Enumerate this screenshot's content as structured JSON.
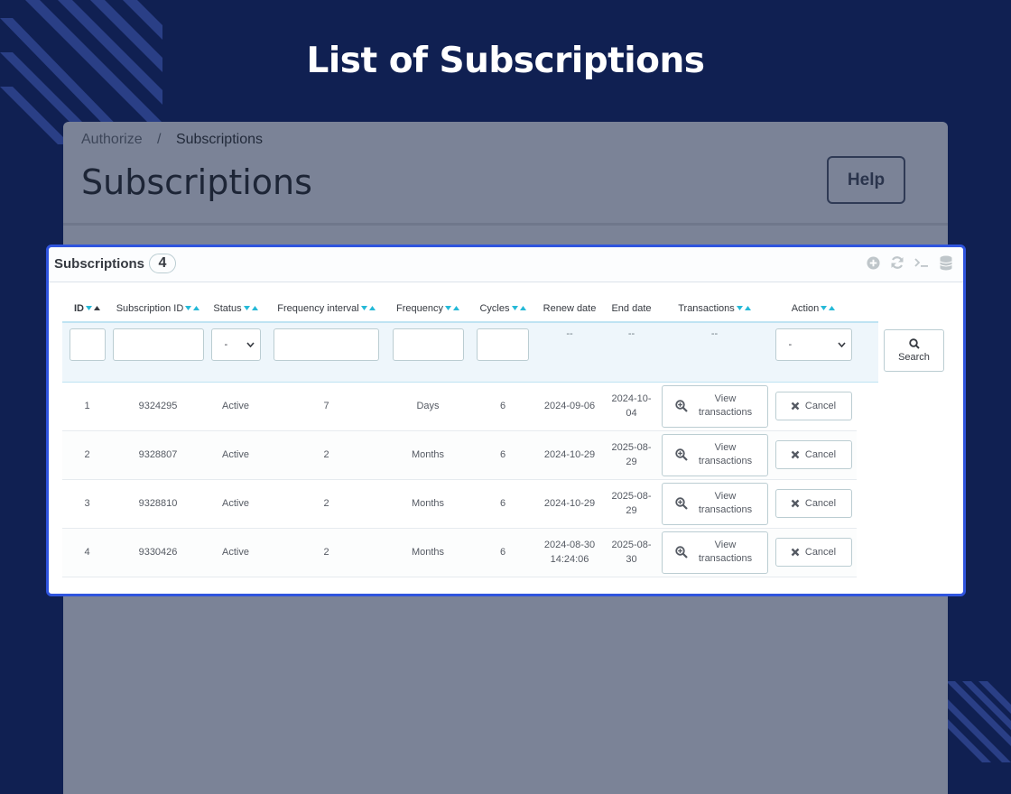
{
  "hero": {
    "title": "List of Subscriptions"
  },
  "background": {
    "breadcrumb": {
      "parent": "Authorize",
      "separator": "/",
      "current": "Subscriptions"
    },
    "page_title": "Subscriptions",
    "help_label": "Help"
  },
  "panel": {
    "title": "Subscriptions",
    "count": "4",
    "icons": [
      "add-icon",
      "refresh-icon",
      "terminal-icon",
      "database-icon"
    ]
  },
  "table": {
    "headers": [
      {
        "label": "ID",
        "sortable": true
      },
      {
        "label": "Subscription ID",
        "sortable": true
      },
      {
        "label": "Status",
        "sortable": true
      },
      {
        "label": "Frequency interval",
        "sortable": true
      },
      {
        "label": "Frequency",
        "sortable": true
      },
      {
        "label": "Cycles",
        "sortable": true
      },
      {
        "label": "Renew date",
        "sortable": false
      },
      {
        "label": "End date",
        "sortable": false
      },
      {
        "label": "Transactions",
        "sortable": true
      },
      {
        "label": "Action",
        "sortable": true
      }
    ],
    "filters": {
      "status_select": "-",
      "renew_placeholder": "--",
      "end_placeholder": "--",
      "transactions_placeholder": "--",
      "action_select": "-",
      "search_label": "Search"
    },
    "rows": [
      {
        "id": "1",
        "subscription_id": "9324295",
        "status": "Active",
        "interval": "7",
        "frequency": "Days",
        "cycles": "6",
        "renew_date": "2024-09-06",
        "renew_time": "",
        "end_date_1": "2024-10-",
        "end_date_2": "04"
      },
      {
        "id": "2",
        "subscription_id": "9328807",
        "status": "Active",
        "interval": "2",
        "frequency": "Months",
        "cycles": "6",
        "renew_date": "2024-10-29",
        "renew_time": "",
        "end_date_1": "2025-08-",
        "end_date_2": "29"
      },
      {
        "id": "3",
        "subscription_id": "9328810",
        "status": "Active",
        "interval": "2",
        "frequency": "Months",
        "cycles": "6",
        "renew_date": "2024-10-29",
        "renew_time": "",
        "end_date_1": "2025-08-",
        "end_date_2": "29"
      },
      {
        "id": "4",
        "subscription_id": "9330426",
        "status": "Active",
        "interval": "2",
        "frequency": "Months",
        "cycles": "6",
        "renew_date": "2024-08-30",
        "renew_time": "14:24:06",
        "end_date_1": "2025-08-",
        "end_date_2": "30"
      }
    ],
    "view_label_1": "View",
    "view_label_2": "transactions",
    "cancel_label": "Cancel"
  },
  "colors": {
    "background": "#102052",
    "panel_overlay": "#7b8397",
    "card_border": "#2f54de",
    "sort_active": "#25b9d7"
  }
}
